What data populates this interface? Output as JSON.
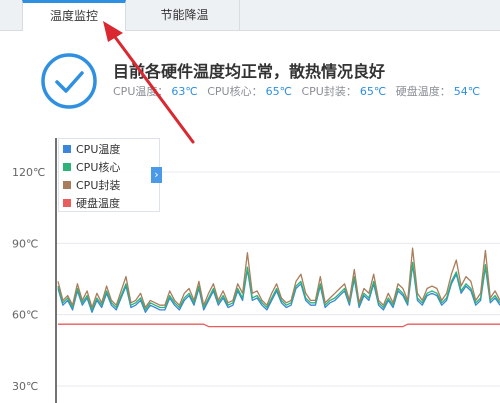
{
  "tabs": [
    {
      "label": "温度监控",
      "active": true
    },
    {
      "label": "节能降温",
      "active": false
    }
  ],
  "status": {
    "title": "目前各硬件温度均正常，散热情况良好",
    "readouts": [
      {
        "label": "CPU温度：",
        "value": "63℃"
      },
      {
        "label": "CPU核心：",
        "value": "65℃"
      },
      {
        "label": "CPU封装：",
        "value": "65℃"
      },
      {
        "label": "硬盘温度：",
        "value": "54℃"
      }
    ]
  },
  "colors": {
    "accent": "#2f8fe0",
    "cpu_temp": "#3a86d8",
    "cpu_core": "#2db37a",
    "cpu_package": "#a97d5b",
    "disk_temp": "#e85c5c",
    "annotation_arrow": "#d9282f"
  },
  "icons": {
    "status": "check-circle-icon",
    "legend_toggle": "chevron-right-icon"
  },
  "chart_data": {
    "type": "line",
    "ylim": [
      30,
      120
    ],
    "yticks": [
      30,
      60,
      90,
      120
    ],
    "ytick_labels": [
      "30℃",
      "60℃",
      "90℃",
      "120℃"
    ],
    "legend": "top-left",
    "grid": true,
    "series": [
      {
        "name": "CPU温度",
        "color": "#3a86d8",
        "values": [
          71,
          64,
          66,
          62,
          70,
          64,
          67,
          61,
          66,
          63,
          69,
          64,
          62,
          67,
          72,
          63,
          64,
          66,
          61,
          64,
          63,
          62,
          62,
          67,
          64,
          62,
          66,
          68,
          64,
          71,
          62,
          66,
          70,
          64,
          67,
          63,
          64,
          70,
          66,
          79,
          66,
          67,
          64,
          62,
          66,
          70,
          65,
          63,
          64,
          71,
          73,
          66,
          64,
          64,
          72,
          63,
          65,
          66,
          68,
          70,
          64,
          75,
          63,
          68,
          66,
          73,
          64,
          62,
          66,
          63,
          70,
          68,
          64,
          81,
          66,
          64,
          68,
          69,
          68,
          64,
          66,
          73,
          77,
          69,
          72,
          70,
          64,
          66,
          80,
          65,
          67,
          64
        ]
      },
      {
        "name": "CPU核心",
        "color": "#2db37a",
        "values": [
          72,
          65,
          67,
          63,
          71,
          65,
          68,
          62,
          67,
          64,
          70,
          65,
          63,
          68,
          73,
          64,
          65,
          67,
          62,
          65,
          64,
          63,
          63,
          68,
          65,
          63,
          67,
          69,
          65,
          72,
          63,
          67,
          71,
          65,
          68,
          64,
          65,
          71,
          67,
          80,
          67,
          68,
          65,
          63,
          67,
          71,
          66,
          64,
          65,
          72,
          74,
          67,
          65,
          65,
          73,
          64,
          66,
          67,
          69,
          71,
          65,
          76,
          64,
          69,
          67,
          74,
          65,
          63,
          67,
          64,
          71,
          69,
          65,
          82,
          67,
          65,
          69,
          70,
          69,
          65,
          67,
          74,
          78,
          70,
          73,
          71,
          65,
          67,
          81,
          66,
          68,
          65
        ]
      },
      {
        "name": "CPU封装",
        "color": "#a97d5b",
        "values": [
          74,
          66,
          68,
          64,
          73,
          66,
          70,
          63,
          69,
          65,
          72,
          66,
          64,
          70,
          76,
          65,
          66,
          69,
          63,
          66,
          65,
          64,
          64,
          70,
          66,
          64,
          69,
          71,
          66,
          74,
          64,
          69,
          73,
          66,
          70,
          65,
          66,
          73,
          69,
          86,
          69,
          70,
          66,
          64,
          69,
          73,
          67,
          65,
          66,
          74,
          77,
          69,
          66,
          66,
          76,
          65,
          67,
          69,
          71,
          73,
          66,
          79,
          65,
          71,
          69,
          77,
          66,
          64,
          69,
          65,
          73,
          71,
          66,
          88,
          69,
          66,
          71,
          72,
          71,
          66,
          69,
          77,
          83,
          72,
          76,
          74,
          66,
          69,
          87,
          67,
          70,
          66
        ]
      },
      {
        "name": "硬盘温度",
        "color": "#e85c5c",
        "values": [
          56,
          56,
          56,
          56,
          56,
          56,
          56,
          56,
          56,
          56,
          56,
          56,
          56,
          56,
          56,
          56,
          56,
          56,
          56,
          56,
          56,
          56,
          56,
          56,
          56,
          56,
          56,
          56,
          56,
          56,
          56,
          55,
          55,
          55,
          55,
          55,
          55,
          55,
          55,
          55,
          55,
          55,
          55,
          55,
          55,
          55,
          55,
          55,
          55,
          55,
          55,
          55,
          55,
          55,
          55,
          55,
          55,
          55,
          55,
          55,
          55,
          55,
          55,
          55,
          55,
          55,
          55,
          55,
          55,
          55,
          55,
          55,
          56,
          56,
          56,
          56,
          56,
          56,
          56,
          56,
          56,
          56,
          56,
          56,
          56,
          56,
          56,
          56,
          56,
          56,
          56,
          56
        ]
      }
    ]
  }
}
